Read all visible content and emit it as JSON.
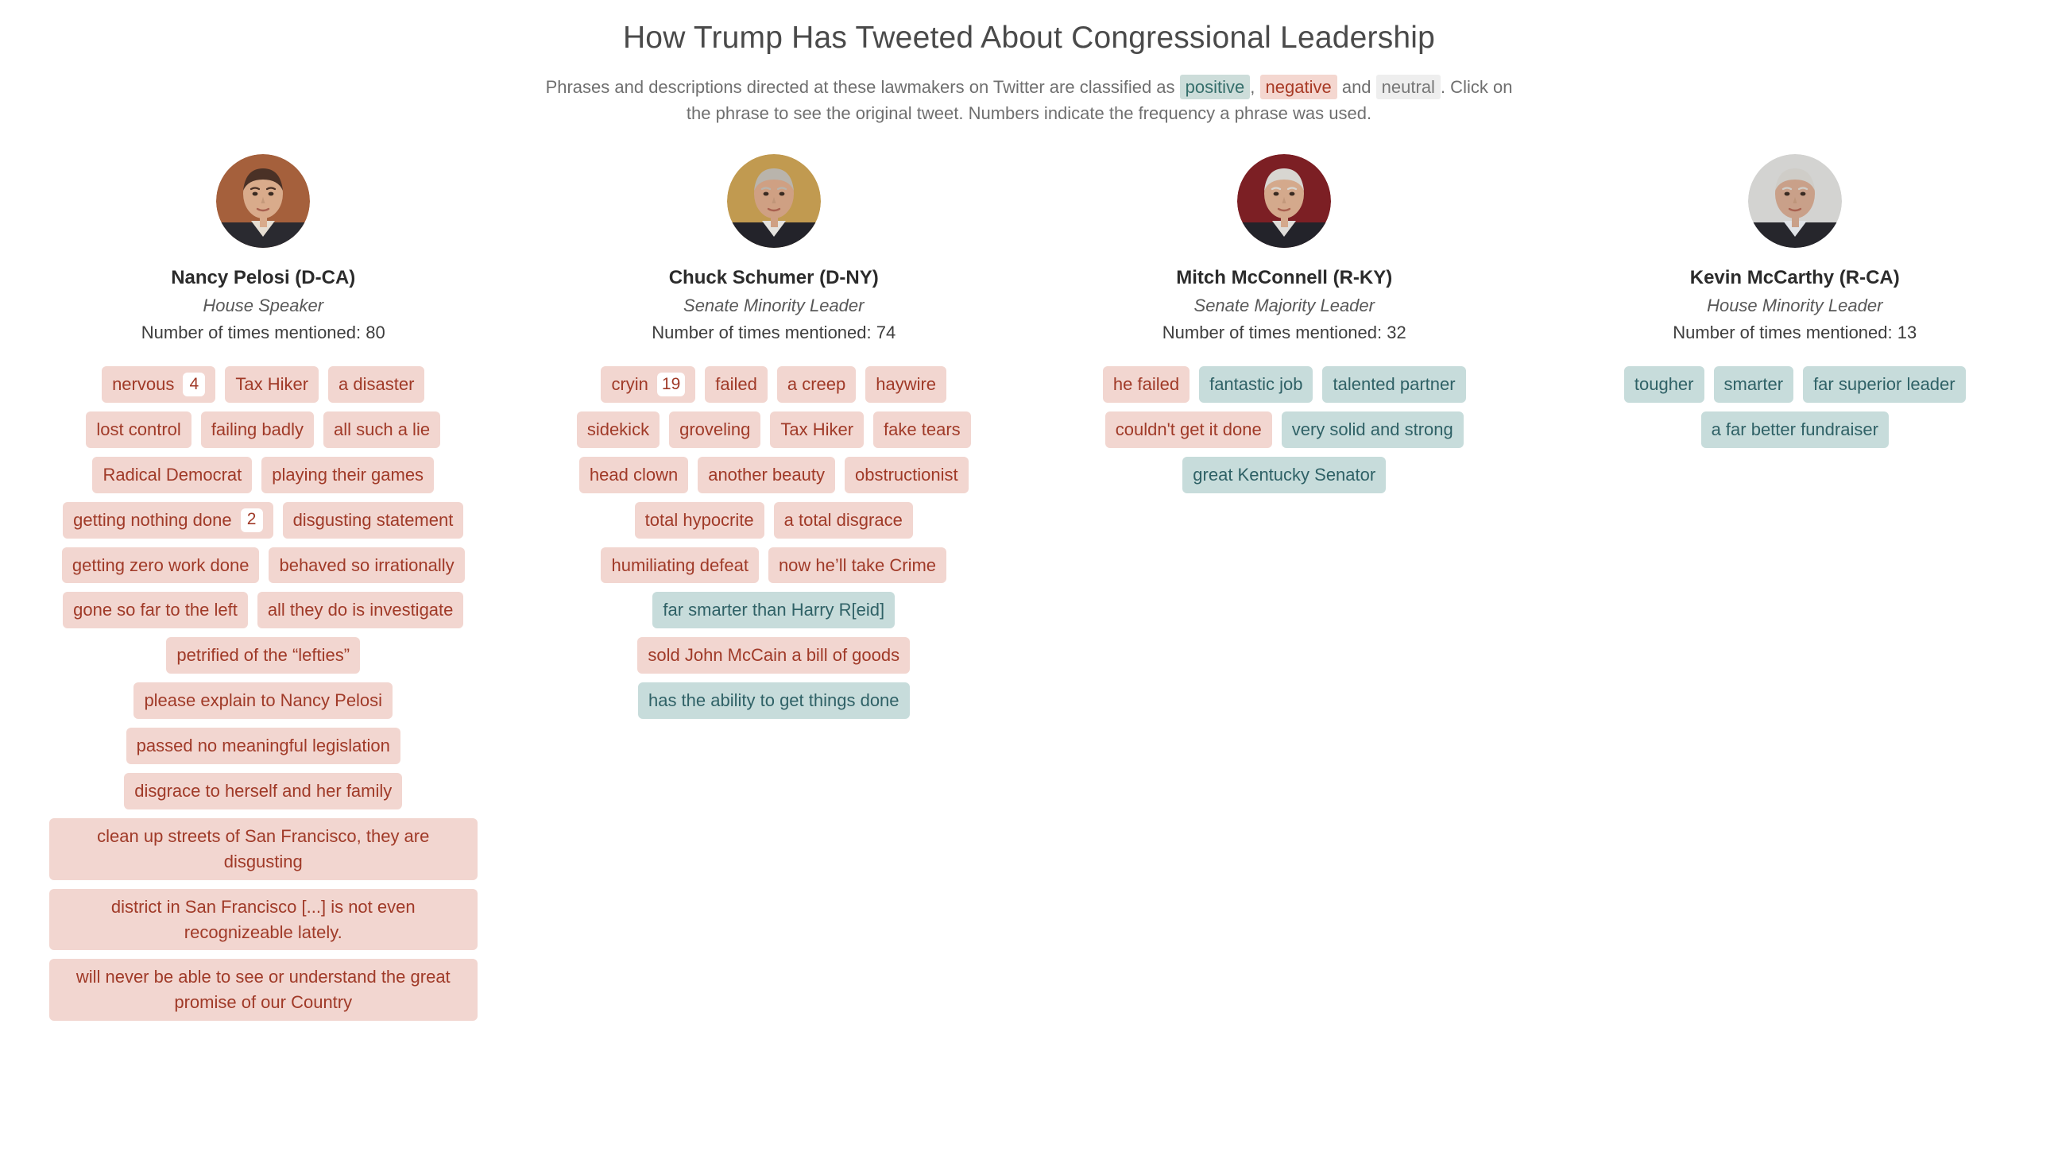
{
  "header": {
    "title": "How Trump Has Tweeted About Congressional Leadership",
    "subtitle_part1": "Phrases and descriptions directed at these lawmakers on Twitter are classified as",
    "chip_positive": "positive",
    "subtitle_comma": ",",
    "chip_negative": "negative",
    "subtitle_and": "and",
    "chip_neutral": "neutral",
    "subtitle_part2": ". Click on the phrase to see the original tweet. Numbers indicate the frequency a phrase was used."
  },
  "colors": {
    "positive_bg": "#c7dcdb",
    "positive_text": "#2f6166",
    "negative_bg": "#f2d6d0",
    "negative_text": "#a03a28",
    "neutral_bg": "#eeeeee",
    "neutral_text": "#777777",
    "title_text": "#4a4a4a"
  },
  "count_label": "Number of times mentioned:",
  "people": [
    {
      "avatar": "nancy-pelosi-photo",
      "avatar_bg": "#a5603c",
      "name": "Nancy Pelosi (D-CA)",
      "role": "House Speaker",
      "count": 80,
      "count_text": "Number of times mentioned: 80",
      "tags": [
        {
          "text": "nervous",
          "sentiment": "negative",
          "count": 4,
          "wide": false
        },
        {
          "text": "Tax Hiker",
          "sentiment": "negative",
          "wide": false
        },
        {
          "text": "a disaster",
          "sentiment": "negative",
          "wide": false
        },
        {
          "text": "lost control",
          "sentiment": "negative",
          "wide": false
        },
        {
          "text": "failing badly",
          "sentiment": "negative",
          "wide": false
        },
        {
          "text": "all such a lie",
          "sentiment": "negative",
          "wide": false
        },
        {
          "text": "Radical Democrat",
          "sentiment": "negative",
          "wide": false
        },
        {
          "text": "playing their games",
          "sentiment": "negative",
          "wide": false
        },
        {
          "text": "getting nothing done",
          "sentiment": "negative",
          "count": 2,
          "wide": false
        },
        {
          "text": "disgusting statement",
          "sentiment": "negative",
          "wide": false
        },
        {
          "text": "getting zero work done",
          "sentiment": "negative",
          "wide": false
        },
        {
          "text": "behaved so irrationally",
          "sentiment": "negative",
          "wide": false
        },
        {
          "text": "gone so far to the left",
          "sentiment": "negative",
          "wide": false
        },
        {
          "text": "all they do is investigate",
          "sentiment": "negative",
          "wide": false
        },
        {
          "text": "petrified of the “lefties”",
          "sentiment": "negative",
          "wide": false
        },
        {
          "text": "please explain to Nancy Pelosi",
          "sentiment": "negative",
          "wide": false
        },
        {
          "text": "passed no meaningful legislation",
          "sentiment": "negative",
          "wide": false
        },
        {
          "text": "disgrace to herself and her family",
          "sentiment": "negative",
          "wide": false
        },
        {
          "text": "clean up streets of San Francisco, they are disgusting",
          "sentiment": "negative",
          "wide": true
        },
        {
          "text": "district in San Francisco [...] is not even recognizeable lately.",
          "sentiment": "negative",
          "wide": true
        },
        {
          "text": "will never be able to see or understand the great promise of our Country",
          "sentiment": "negative",
          "wide": true
        }
      ]
    },
    {
      "avatar": "chuck-schumer-photo",
      "avatar_bg": "#c19a50",
      "name": "Chuck Schumer (D-NY)",
      "role": "Senate Minority Leader",
      "count": 74,
      "count_text": "Number of times mentioned: 74",
      "tags": [
        {
          "text": "cryin",
          "sentiment": "negative",
          "count": 19,
          "wide": false
        },
        {
          "text": "failed",
          "sentiment": "negative",
          "wide": false
        },
        {
          "text": "a creep",
          "sentiment": "negative",
          "wide": false
        },
        {
          "text": "haywire",
          "sentiment": "negative",
          "wide": false
        },
        {
          "text": "sidekick",
          "sentiment": "negative",
          "wide": false
        },
        {
          "text": "groveling",
          "sentiment": "negative",
          "wide": false
        },
        {
          "text": "Tax Hiker",
          "sentiment": "negative",
          "wide": false
        },
        {
          "text": "fake tears",
          "sentiment": "negative",
          "wide": false
        },
        {
          "text": "head clown",
          "sentiment": "negative",
          "wide": false
        },
        {
          "text": "another beauty",
          "sentiment": "negative",
          "wide": false
        },
        {
          "text": "obstructionist",
          "sentiment": "negative",
          "wide": false
        },
        {
          "text": "total hypocrite",
          "sentiment": "negative",
          "wide": false
        },
        {
          "text": "a total disgrace",
          "sentiment": "negative",
          "wide": false
        },
        {
          "text": "humiliating defeat",
          "sentiment": "negative",
          "wide": false
        },
        {
          "text": "now he’ll take Crime",
          "sentiment": "negative",
          "wide": false
        },
        {
          "text": "far smarter than Harry R[eid]",
          "sentiment": "positive",
          "wide": false
        },
        {
          "text": "sold John McCain a bill of goods",
          "sentiment": "negative",
          "wide": false
        },
        {
          "text": "has the ability to get things done",
          "sentiment": "positive",
          "wide": false
        }
      ]
    },
    {
      "avatar": "mitch-mcconnell-photo",
      "avatar_bg": "#7c1f24",
      "name": "Mitch McConnell (R-KY)",
      "role": "Senate Majority Leader",
      "count": 32,
      "count_text": "Number of times mentioned: 32",
      "tags": [
        {
          "text": "he failed",
          "sentiment": "negative",
          "wide": false
        },
        {
          "text": "fantastic job",
          "sentiment": "positive",
          "wide": false
        },
        {
          "text": "talented partner",
          "sentiment": "positive",
          "wide": false
        },
        {
          "text": "couldn't get it done",
          "sentiment": "negative",
          "wide": false
        },
        {
          "text": "very solid and strong",
          "sentiment": "positive",
          "wide": false
        },
        {
          "text": "great Kentucky Senator",
          "sentiment": "positive",
          "wide": false
        }
      ]
    },
    {
      "avatar": "kevin-mccarthy-photo",
      "avatar_bg": "#d3d3d1",
      "name": "Kevin McCarthy (R-CA)",
      "role": "House Minority Leader",
      "count": 13,
      "count_text": "Number of times mentioned: 13",
      "tags": [
        {
          "text": "tougher",
          "sentiment": "positive",
          "wide": false
        },
        {
          "text": "smarter",
          "sentiment": "positive",
          "wide": false
        },
        {
          "text": "far superior leader",
          "sentiment": "positive",
          "wide": false
        },
        {
          "text": "a far better fundraiser",
          "sentiment": "positive",
          "wide": false
        }
      ]
    }
  ]
}
